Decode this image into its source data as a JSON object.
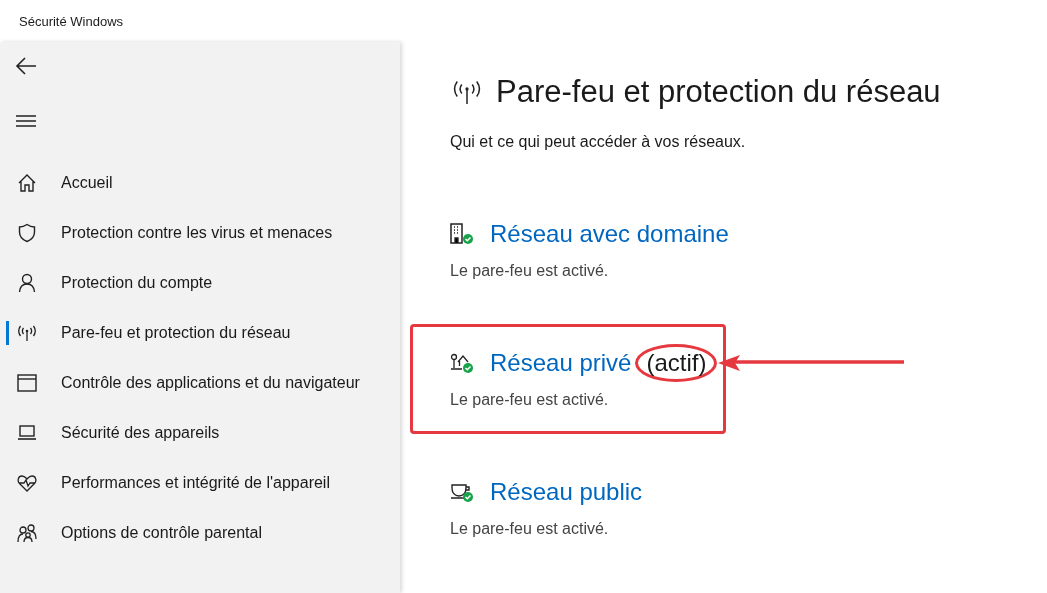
{
  "window": {
    "title": "Sécurité Windows"
  },
  "sidebar": {
    "items": [
      {
        "kind": "home",
        "label": "Accueil",
        "selected": false
      },
      {
        "kind": "shield",
        "label": "Protection contre les virus et menaces",
        "selected": false
      },
      {
        "kind": "person",
        "label": "Protection du compte",
        "selected": false
      },
      {
        "kind": "antenna",
        "label": "Pare-feu et protection du réseau",
        "selected": true
      },
      {
        "kind": "window",
        "label": "Contrôle des applications et du navigateur",
        "selected": false
      },
      {
        "kind": "laptop",
        "label": "Sécurité des appareils",
        "selected": false
      },
      {
        "kind": "heart",
        "label": "Performances et intégrité de l'appareil",
        "selected": false
      },
      {
        "kind": "family",
        "label": "Options de contrôle parental",
        "selected": false
      }
    ]
  },
  "page": {
    "title": "Pare-feu et protection du réseau",
    "subtitle": "Qui et ce qui peut accéder à vos réseaux.",
    "networks": [
      {
        "kind": "domain",
        "name": "Réseau avec domaine",
        "status": "Le pare-feu est activé.",
        "highlighted": false
      },
      {
        "kind": "private",
        "name": "Réseau privé",
        "active_label": "(actif)",
        "status": "Le pare-feu est activé.",
        "highlighted": true
      },
      {
        "kind": "public",
        "name": "Réseau public",
        "status": "Le pare-feu est activé.",
        "highlighted": false
      }
    ]
  }
}
